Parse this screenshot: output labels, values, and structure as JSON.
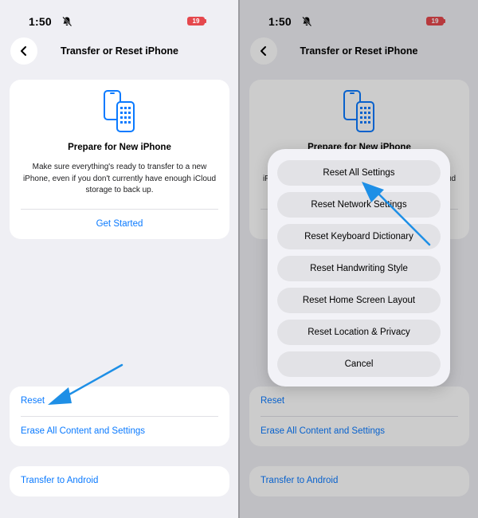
{
  "status": {
    "time": "1:50",
    "battery": "19"
  },
  "nav": {
    "title": "Transfer or Reset iPhone"
  },
  "prepare": {
    "title": "Prepare for New iPhone",
    "description": "Make sure everything's ready to transfer to a new iPhone, even if you don't currently have enough iCloud storage to back up.",
    "get_started": "Get Started"
  },
  "reset_section": {
    "reset_label": "Reset",
    "erase_label": "Erase All Content and Settings"
  },
  "android": {
    "label": "Transfer to Android"
  },
  "reset_sheet": {
    "options": [
      "Reset All Settings",
      "Reset Network Settings",
      "Reset Keyboard Dictionary",
      "Reset Handwriting Style",
      "Reset Home Screen Layout",
      "Reset Location & Privacy"
    ],
    "cancel": "Cancel"
  },
  "colors": {
    "accent": "#0a7aff",
    "annotation_arrow": "#1e8fe6",
    "background": "#efeff4"
  }
}
